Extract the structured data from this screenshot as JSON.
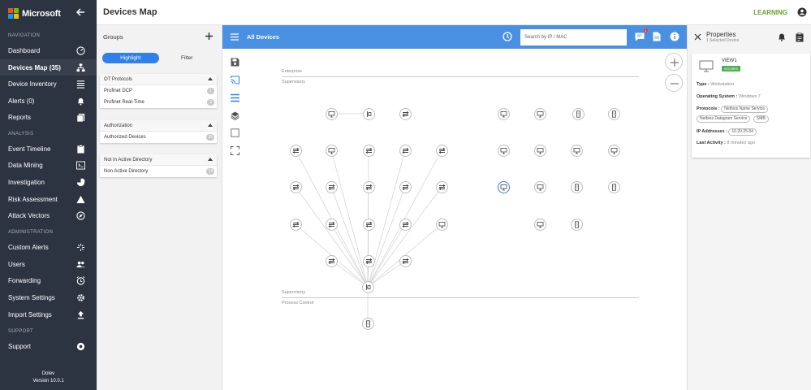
{
  "app": {
    "logo_text": "Microsoft",
    "brand_colors": [
      "#f25022",
      "#7fba00",
      "#00a4ef",
      "#ffb900"
    ]
  },
  "sidebar": {
    "sections": [
      "NAVIGATION",
      "ANALYSIS",
      "ADMINISTRATION",
      "SUPPORT"
    ],
    "items": [
      {
        "label": "Dashboard",
        "icon": "speedometer-icon"
      },
      {
        "label": "Devices Map (35)",
        "icon": "device-map-icon",
        "active": true
      },
      {
        "label": "Device Inventory",
        "icon": "list-icon"
      },
      {
        "label": "Alerts (0)",
        "icon": "bell-icon"
      },
      {
        "label": "Reports",
        "icon": "reports-icon"
      },
      {
        "label": "Event Timeline",
        "icon": "clipboard-icon"
      },
      {
        "label": "Data Mining",
        "icon": "terminal-icon"
      },
      {
        "label": "Investigation",
        "icon": "pie-chart-icon"
      },
      {
        "label": "Risk Assessment",
        "icon": "warning-icon"
      },
      {
        "label": "Attack Vectors",
        "icon": "compass-icon"
      },
      {
        "label": "Custom Alerts",
        "icon": "sparkle-icon"
      },
      {
        "label": "Users",
        "icon": "users-icon"
      },
      {
        "label": "Forwarding",
        "icon": "alarm-clock-icon"
      },
      {
        "label": "System Settings",
        "icon": "gear-icon"
      },
      {
        "label": "Import Settings",
        "icon": "upload-icon"
      },
      {
        "label": "Support",
        "icon": "lifebuoy-icon"
      }
    ],
    "footer_user": "Dolev",
    "footer_version": "Version 10.0.1"
  },
  "header": {
    "title": "Devices Map",
    "learning_label": "LEARNING",
    "learning_color": "#6aa22c"
  },
  "groups": {
    "title": "Groups",
    "toggle": {
      "highlight": "Highlight",
      "filter": "Filter"
    },
    "cards": [
      {
        "header": "OT Protocols",
        "rows": [
          {
            "label": "Profinet DCP",
            "count": "1"
          },
          {
            "label": "Profinet Real-Time",
            "count": "3"
          }
        ]
      },
      {
        "header": "Authorization",
        "rows": [
          {
            "label": "Authorized Devices",
            "count": "35"
          }
        ]
      },
      {
        "header": "Not In Active Directory",
        "rows": [
          {
            "label": "Non Active Directory",
            "count": "14"
          }
        ]
      }
    ]
  },
  "mapbar": {
    "title": "All Devices",
    "search_placeholder": "Search by IP / MAC",
    "notification_count": "1",
    "bar_color": "#4a90e2"
  },
  "map": {
    "layers": [
      "Enterprise",
      "Supervisory",
      "Supervisory",
      "Process Control"
    ]
  },
  "properties": {
    "title": "Properties",
    "subtitle": "1 Selected Device",
    "device_name": "VIEW1",
    "status_badge": "SECURED",
    "type_label": "Type :",
    "type_value": "Workstation",
    "os_label": "Operating System :",
    "os_value": "Windows 7",
    "protocols_label": "Protocols :",
    "protocols": [
      "Netbios Name Service",
      "Netbios Datagram Service",
      "SMB"
    ],
    "ip_label": "IP Addresses :",
    "ip_value": "10.20.25.84",
    "activity_label": "Last Activity :",
    "activity_value": "8 minutes ago"
  }
}
